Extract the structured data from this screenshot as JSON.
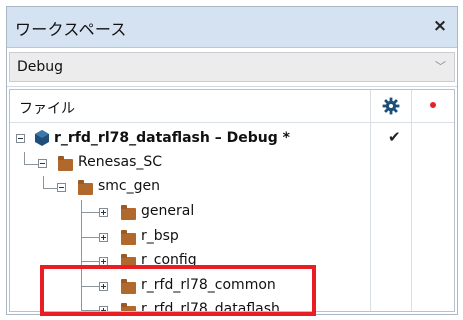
{
  "window": {
    "title": "ワークスペース",
    "close_label": "×"
  },
  "config": {
    "selected": "Debug"
  },
  "tree": {
    "header_label": "ファイル",
    "project": {
      "label": "r_rfd_rl78_dataflash – Debug *",
      "check": "✔"
    },
    "items": [
      {
        "label": "Renesas_SC"
      },
      {
        "label": "smc_gen"
      },
      {
        "label": "general"
      },
      {
        "label": "r_bsp"
      },
      {
        "label": "r_config"
      },
      {
        "label": "r_rfd_rl78_common"
      },
      {
        "label": "r_rfd_rl78_dataflash"
      }
    ]
  },
  "colors": {
    "accent": "#d4e2f1",
    "folder": "#b0682d",
    "project_icon": "#1d4f7a",
    "highlight": "#ea1c24",
    "dot": "#e8202a"
  }
}
